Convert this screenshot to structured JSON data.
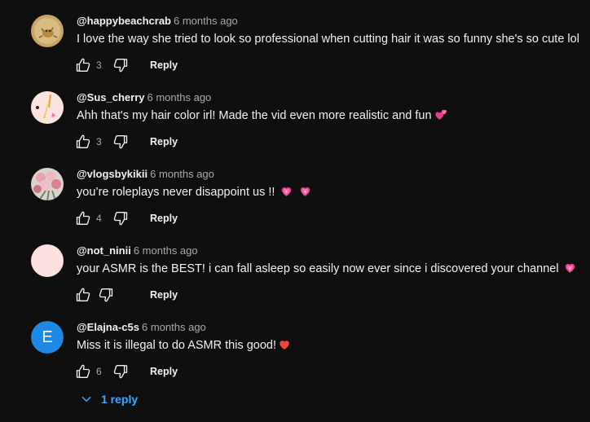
{
  "comments": [
    {
      "author": "@happybeachcrab",
      "time": "6 months ago",
      "text": "I love the way she tried to look so professional when cutting hair it was so funny she's so cute lol",
      "likes": "3",
      "reply_label": "Reply",
      "avatar_icon": "crab-photo"
    },
    {
      "author": "@Sus_cherry",
      "time": "6 months ago",
      "text": "Ahh that's my hair color irl! Made the vid even more realistic and fun",
      "likes": "3",
      "reply_label": "Reply",
      "avatar_icon": "cherry-photo",
      "emoji": "two-hearts"
    },
    {
      "author": "@vlogsbykikii",
      "time": "6 months ago",
      "text": "you’re roleplays never disappoint us !!",
      "likes": "4",
      "reply_label": "Reply",
      "avatar_icon": "flowers-photo",
      "emoji": "sparkling-heart x2"
    },
    {
      "author": "@not_ninii",
      "time": "6 months ago",
      "text": "your ASMR is the BEST! i can fall asleep so easily now ever since i discovered your channel",
      "likes": "",
      "reply_label": "Reply",
      "avatar_color": "#fde0e0",
      "emoji": "sparkling-heart"
    },
    {
      "author": "@Elajna-c5s",
      "time": "6 months ago",
      "text": "Miss it is illegal to do ASMR this good!",
      "likes": "6",
      "reply_label": "Reply",
      "avatar_letter": "E",
      "avatar_color": "#1e88e5",
      "emoji": "red-heart"
    }
  ],
  "replies_toggle": {
    "label": "1 reply",
    "icon": "chevron-down-icon"
  },
  "colors": {
    "background": "#0f0f0f",
    "text": "#f1f1f1",
    "secondary_text": "#aaaaaa",
    "link_blue": "#3ea6ff"
  }
}
